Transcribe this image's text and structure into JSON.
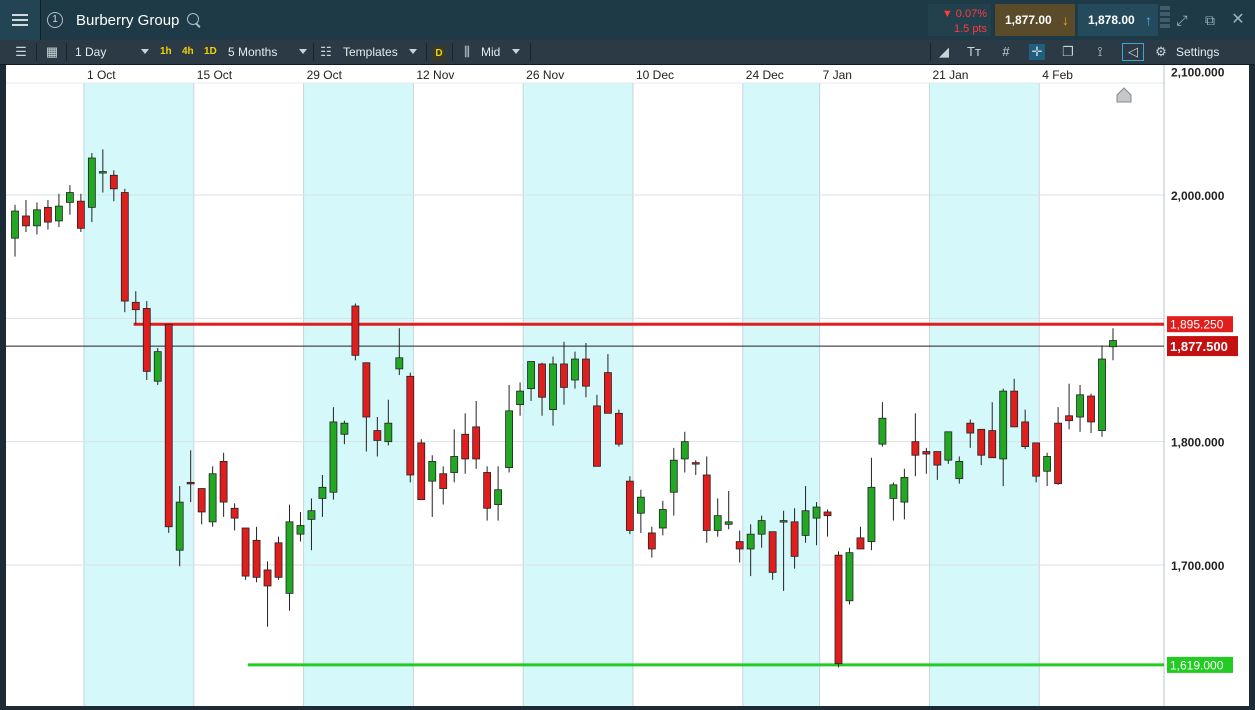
{
  "header": {
    "instrument": "Burberry Group",
    "info_icon": "info-circle-icon",
    "change_pct": "▼ 0.07%",
    "change_pts": "1.5 pts",
    "sell_price": "1,877.00",
    "buy_price": "1,878.00",
    "sell_arrow": "↓",
    "buy_arrow": "↑"
  },
  "toolbar": {
    "interval": "1 Day",
    "btn_1h": "1h",
    "btn_4h": "4h",
    "btn_1d": "1D",
    "range": "5 Months",
    "templates": "Templates",
    "tag_d": "D",
    "price_type": "Mid",
    "settings": "Settings"
  },
  "colors": {
    "bull": "#23a823",
    "bear": "#e01e1e",
    "shade": "#d5f8fa",
    "resistance": "#e01e1e",
    "support": "#22cc22",
    "current": "#c41010"
  },
  "chart_data": {
    "type": "candlestick",
    "x_ticks": [
      "1 Oct",
      "15 Oct",
      "29 Oct",
      "12 Nov",
      "26 Nov",
      "10 Dec",
      "24 Dec",
      "7 Jan",
      "21 Jan",
      "4 Feb"
    ],
    "y_ticks": [
      "1,700.000",
      "1,800.000",
      "2,000.000",
      "2,100.000"
    ],
    "ylim": [
      1575,
      2110
    ],
    "levels": [
      {
        "label": "1,895.250",
        "value": 1895.25,
        "color": "#e01e1e",
        "kind": "resistance"
      },
      {
        "label": "1,877.500",
        "value": 1877.5,
        "color": "#c41010",
        "kind": "current"
      },
      {
        "label": "1,619.000",
        "value": 1619,
        "color": "#22cc22",
        "kind": "support"
      }
    ],
    "candles": [
      [
        1965,
        1987,
        1950,
        1992
      ],
      [
        1983,
        1975,
        1970,
        1996
      ],
      [
        1975,
        1988,
        1968,
        1994
      ],
      [
        1990,
        1978,
        1972,
        1996
      ],
      [
        1979,
        1991,
        1974,
        2001
      ],
      [
        1994,
        2002,
        1984,
        2008
      ],
      [
        1995,
        1973,
        1970,
        2001
      ],
      [
        1990,
        2030,
        1978,
        2034
      ],
      [
        2018,
        2019,
        2002,
        2037
      ],
      [
        2016,
        2005,
        1995,
        2020
      ],
      [
        2002,
        1914,
        1905,
        2005
      ],
      [
        1913,
        1907,
        1895,
        1922
      ],
      [
        1908,
        1857,
        1850,
        1914
      ],
      [
        1849,
        1873,
        1846,
        1876
      ],
      [
        1895,
        1731,
        1726,
        1895
      ],
      [
        1712,
        1751,
        1699,
        1764
      ],
      [
        1767,
        1766,
        1751,
        1793
      ],
      [
        1762,
        1743,
        1733,
        1762
      ],
      [
        1735,
        1774,
        1731,
        1780
      ],
      [
        1784,
        1751,
        1739,
        1791
      ],
      [
        1746,
        1738,
        1728,
        1750
      ],
      [
        1730,
        1691,
        1688,
        1730
      ],
      [
        1720,
        1690,
        1686,
        1731
      ],
      [
        1696,
        1683,
        1650,
        1703
      ],
      [
        1718,
        1690,
        1688,
        1723
      ],
      [
        1677,
        1735,
        1663,
        1749
      ],
      [
        1725,
        1732,
        1719,
        1743
      ],
      [
        1737,
        1744,
        1712,
        1754
      ],
      [
        1754,
        1763,
        1739,
        1773
      ],
      [
        1759,
        1816,
        1753,
        1828
      ],
      [
        1806,
        1815,
        1798,
        1817
      ],
      [
        1910,
        1870,
        1866,
        1912
      ],
      [
        1864,
        1820,
        1792,
        1864
      ],
      [
        1809,
        1801,
        1788,
        1820
      ],
      [
        1800,
        1815,
        1797,
        1834
      ],
      [
        1859,
        1868,
        1854,
        1892
      ],
      [
        1853,
        1773,
        1767,
        1856
      ],
      [
        1799,
        1753,
        1755,
        1802
      ],
      [
        1768,
        1784,
        1739,
        1789
      ],
      [
        1774,
        1762,
        1749,
        1780
      ],
      [
        1775,
        1788,
        1767,
        1810
      ],
      [
        1806,
        1786,
        1774,
        1823
      ],
      [
        1812,
        1786,
        1778,
        1833
      ],
      [
        1775,
        1746,
        1736,
        1780
      ],
      [
        1749,
        1761,
        1736,
        1780
      ],
      [
        1779,
        1825,
        1775,
        1846
      ],
      [
        1830,
        1841,
        1821,
        1848
      ],
      [
        1843,
        1865,
        1833,
        1858
      ],
      [
        1863,
        1836,
        1821,
        1864
      ],
      [
        1826,
        1863,
        1813,
        1869
      ],
      [
        1863,
        1844,
        1830,
        1881
      ],
      [
        1850,
        1867,
        1843,
        1873
      ],
      [
        1867,
        1845,
        1836,
        1880
      ],
      [
        1829,
        1780,
        1781,
        1838
      ],
      [
        1856,
        1823,
        1830,
        1871
      ],
      [
        1823,
        1798,
        1796,
        1826
      ],
      [
        1768,
        1728,
        1725,
        1772
      ],
      [
        1742,
        1755,
        1726,
        1761
      ],
      [
        1726,
        1713,
        1706,
        1731
      ],
      [
        1730,
        1745,
        1724,
        1752
      ],
      [
        1759,
        1785,
        1740,
        1795
      ],
      [
        1786,
        1800,
        1775,
        1808
      ],
      [
        1783,
        1782,
        1773,
        1785
      ],
      [
        1773,
        1728,
        1718,
        1788
      ],
      [
        1728,
        1740,
        1723,
        1754
      ],
      [
        1733,
        1735,
        1729,
        1760
      ],
      [
        1719,
        1713,
        1702,
        1728
      ],
      [
        1713,
        1725,
        1691,
        1733
      ],
      [
        1725,
        1736,
        1714,
        1740
      ],
      [
        1727,
        1694,
        1688,
        1727
      ],
      [
        1736,
        1736,
        1679,
        1744
      ],
      [
        1735,
        1707,
        1697,
        1746
      ],
      [
        1724,
        1744,
        1718,
        1764
      ],
      [
        1738,
        1747,
        1716,
        1751
      ],
      [
        1743,
        1740,
        1723,
        1745
      ],
      [
        1708,
        1620,
        1617,
        1711
      ],
      [
        1671,
        1710,
        1668,
        1714
      ],
      [
        1722,
        1713,
        1718,
        1731
      ],
      [
        1719,
        1763,
        1712,
        1787
      ],
      [
        1798,
        1819,
        1796,
        1832
      ],
      [
        1754,
        1765,
        1736,
        1767
      ],
      [
        1751,
        1771,
        1737,
        1778
      ],
      [
        1800,
        1789,
        1772,
        1823
      ],
      [
        1792,
        1790,
        1774,
        1795
      ],
      [
        1792,
        1781,
        1769,
        1792
      ],
      [
        1785,
        1808,
        1782,
        1802
      ],
      [
        1770,
        1784,
        1766,
        1788
      ],
      [
        1815,
        1807,
        1795,
        1818
      ],
      [
        1810,
        1789,
        1781,
        1808
      ],
      [
        1809,
        1787,
        1792,
        1832
      ],
      [
        1786,
        1841,
        1764,
        1843
      ],
      [
        1841,
        1812,
        1813,
        1851
      ],
      [
        1816,
        1796,
        1794,
        1826
      ],
      [
        1799,
        1772,
        1767,
        1799
      ],
      [
        1776,
        1788,
        1764,
        1791
      ],
      [
        1815,
        1766,
        1765,
        1828
      ],
      [
        1821,
        1817,
        1810,
        1847
      ],
      [
        1820,
        1838,
        1808,
        1846
      ],
      [
        1837,
        1816,
        1807,
        1839
      ],
      [
        1809,
        1867,
        1804,
        1878
      ],
      [
        1877,
        1882,
        1866,
        1892
      ]
    ]
  }
}
